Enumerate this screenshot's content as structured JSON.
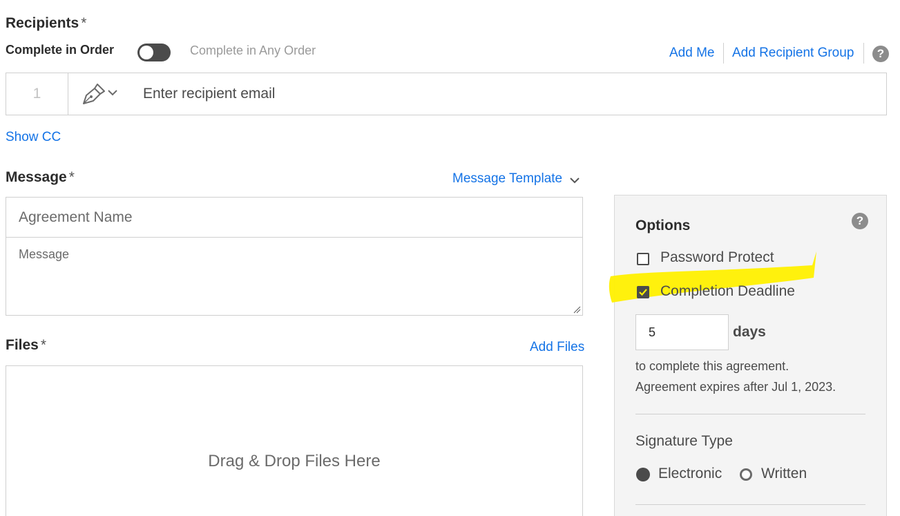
{
  "recipients": {
    "title": "Recipients",
    "required_mark": "*",
    "order_label": "Complete in Order",
    "any_order_label": "Complete in Any Order",
    "toggle_on": false,
    "add_me": "Add Me",
    "add_group": "Add Recipient Group",
    "help": "?",
    "row": {
      "number": "1",
      "role_icon": "pen-signer-icon",
      "email_placeholder": "Enter recipient email"
    },
    "show_cc": "Show CC"
  },
  "message": {
    "title": "Message",
    "required_mark": "*",
    "template_link": "Message Template",
    "agreement_name_placeholder": "Agreement Name",
    "message_placeholder": "Message"
  },
  "files": {
    "title": "Files",
    "required_mark": "*",
    "add_files": "Add Files",
    "dropzone_text": "Drag & Drop Files Here"
  },
  "options": {
    "title": "Options",
    "help": "?",
    "password_protect": {
      "label": "Password Protect",
      "checked": false
    },
    "completion_deadline": {
      "label": "Completion Deadline",
      "checked": true
    },
    "days_value": "5",
    "days_label": "days",
    "complete_text": "to complete this agreement.",
    "expires_text": "Agreement expires after Jul 1, 2023.",
    "signature_type": {
      "title": "Signature Type",
      "electronic": "Electronic",
      "written": "Written",
      "selected": "Electronic"
    }
  },
  "colors": {
    "link": "#1473e6",
    "highlight": "#fff000",
    "panel_bg": "#f4f4f4"
  }
}
